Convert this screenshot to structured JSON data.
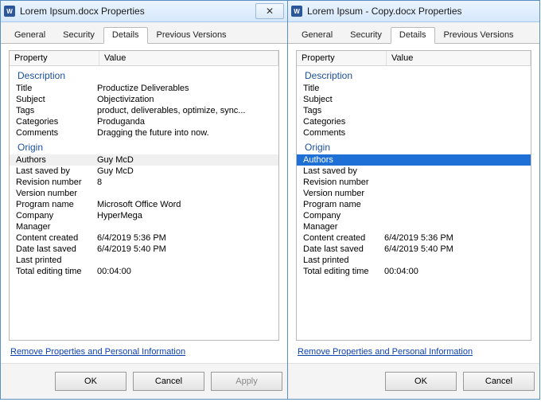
{
  "left": {
    "title": "Lorem Ipsum.docx Properties",
    "close": "✕",
    "tabs": {
      "general": "General",
      "security": "Security",
      "details": "Details",
      "prev": "Previous Versions"
    },
    "header": {
      "prop": "Property",
      "val": "Value"
    },
    "sections": {
      "description": "Description",
      "origin": "Origin"
    },
    "rows": {
      "title_l": "Title",
      "title_v": "Productize Deliverables",
      "subject_l": "Subject",
      "subject_v": "Objectivization",
      "tags_l": "Tags",
      "tags_v": "product, deliverables, optimize, sync...",
      "categories_l": "Categories",
      "categories_v": "Produganda",
      "comments_l": "Comments",
      "comments_v": "Dragging the future into now.",
      "authors_l": "Authors",
      "authors_v": "Guy McD",
      "lastsaved_l": "Last saved by",
      "lastsaved_v": "Guy McD",
      "rev_l": "Revision number",
      "rev_v": "8",
      "ver_l": "Version number",
      "ver_v": "",
      "prog_l": "Program name",
      "prog_v": "Microsoft Office Word",
      "company_l": "Company",
      "company_v": "HyperMega",
      "manager_l": "Manager",
      "manager_v": "",
      "created_l": "Content created",
      "created_v": "6/4/2019 5:36 PM",
      "saved_l": "Date last saved",
      "saved_v": "6/4/2019 5:40 PM",
      "printed_l": "Last printed",
      "printed_v": "",
      "edit_l": "Total editing time",
      "edit_v": "00:04:00"
    },
    "link": "Remove Properties and Personal Information",
    "buttons": {
      "ok": "OK",
      "cancel": "Cancel",
      "apply": "Apply"
    }
  },
  "right": {
    "title": "Lorem Ipsum - Copy.docx Properties",
    "close": "✕",
    "tabs": {
      "general": "General",
      "security": "Security",
      "details": "Details",
      "prev": "Previous Versions"
    },
    "header": {
      "prop": "Property",
      "val": "Value"
    },
    "sections": {
      "description": "Description",
      "origin": "Origin"
    },
    "rows": {
      "title_l": "Title",
      "title_v": "",
      "subject_l": "Subject",
      "subject_v": "",
      "tags_l": "Tags",
      "tags_v": "",
      "categories_l": "Categories",
      "categories_v": "",
      "comments_l": "Comments",
      "comments_v": "",
      "authors_l": "Authors",
      "authors_v": "",
      "lastsaved_l": "Last saved by",
      "lastsaved_v": "",
      "rev_l": "Revision number",
      "rev_v": "",
      "ver_l": "Version number",
      "ver_v": "",
      "prog_l": "Program name",
      "prog_v": "",
      "company_l": "Company",
      "company_v": "",
      "manager_l": "Manager",
      "manager_v": "",
      "created_l": "Content created",
      "created_v": "6/4/2019 5:36 PM",
      "saved_l": "Date last saved",
      "saved_v": "6/4/2019 5:40 PM",
      "printed_l": "Last printed",
      "printed_v": "",
      "edit_l": "Total editing time",
      "edit_v": "00:04:00"
    },
    "link": "Remove Properties and Personal Information",
    "buttons": {
      "ok": "OK",
      "cancel": "Cancel"
    }
  }
}
